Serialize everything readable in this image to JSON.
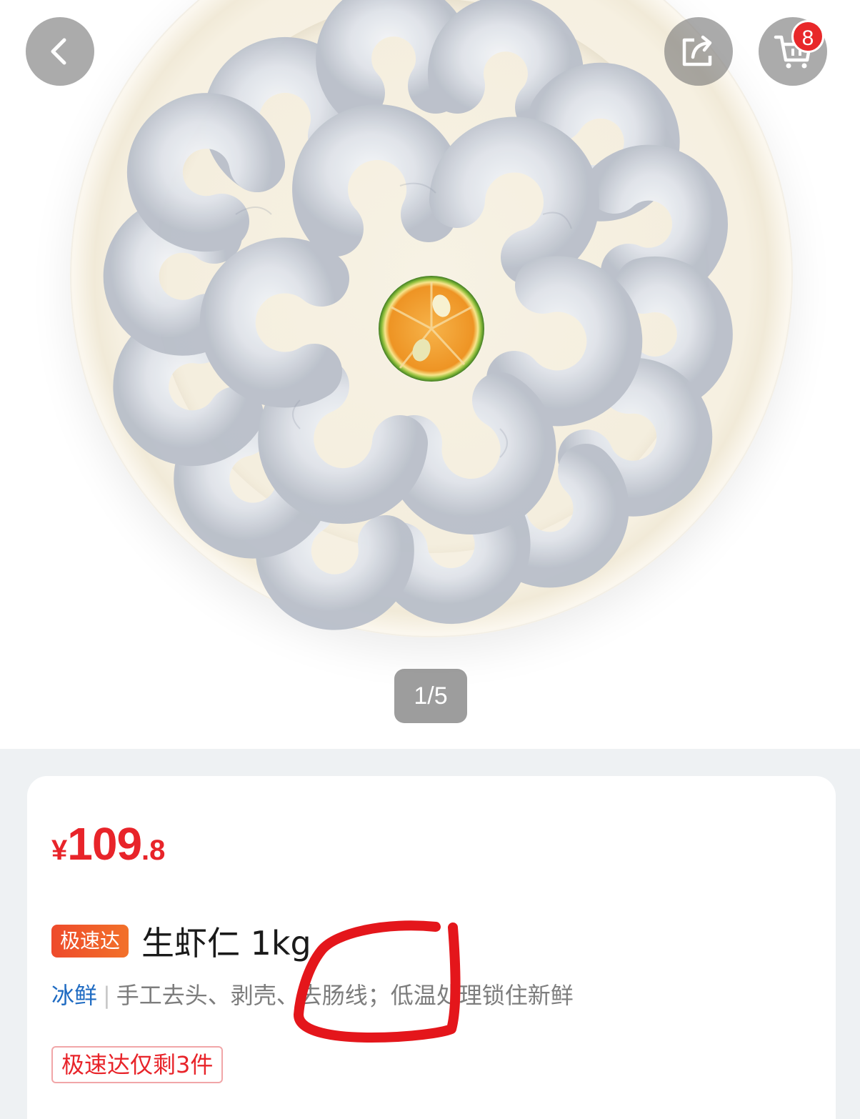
{
  "header": {
    "back_icon": "chevron-left-icon",
    "share_icon": "share-icon",
    "cart_icon": "shopping-cart-icon",
    "cart_count": "8"
  },
  "gallery": {
    "pager": "1/5"
  },
  "product": {
    "price_currency": "¥",
    "price_integer": "109",
    "price_decimal": ".8",
    "delivery_tag": "极速达",
    "title": "生虾仁 1kg",
    "storage_type": "冰鲜",
    "separator": "|",
    "description": "手工去头、剥壳、去肠线；低温处理锁住新鲜",
    "stock_notice": "极速达仅剩3件"
  },
  "colors": {
    "price_red": "#e8242a",
    "badge_red": "#e8282a",
    "fresh_blue": "#1f6bc2",
    "annotation_red": "#e4161b"
  }
}
